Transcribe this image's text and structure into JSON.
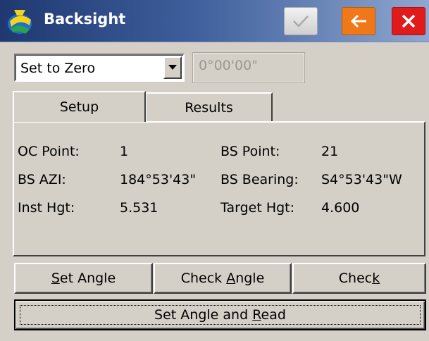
{
  "window": {
    "title": "Backsight",
    "buttons": {
      "ok": "checkmark-icon",
      "back": "back-arrow-icon",
      "close": "close-icon"
    },
    "colors": {
      "titlebar": "#1f3870",
      "back": "#f07818",
      "close": "#e01b1b"
    }
  },
  "mode_select": {
    "value": "Set to Zero"
  },
  "angle_field": {
    "value": "0°00'00\""
  },
  "tabs": [
    {
      "label": "Setup",
      "active": true
    },
    {
      "label": "Results",
      "active": false
    }
  ],
  "setup": {
    "oc_point_label": "OC Point:",
    "oc_point_value": "1",
    "bs_point_label": "BS Point:",
    "bs_point_value": "21",
    "bs_azi_label": "BS AZI:",
    "bs_azi_value": "184°53'43\"",
    "bs_bearing_label": "BS Bearing:",
    "bs_bearing_value": "S4°53'43\"W",
    "inst_hgt_label": "Inst Hgt:",
    "inst_hgt_value": "5.531",
    "target_hgt_label": "Target Hgt:",
    "target_hgt_value": "4.600"
  },
  "actions": {
    "set_angle": {
      "pre": "",
      "key": "S",
      "post": "et Angle"
    },
    "check_angle": {
      "pre": "Check ",
      "key": "A",
      "post": "ngle"
    },
    "check": {
      "pre": "Chec",
      "key": "k",
      "post": ""
    },
    "set_angle_and_read": {
      "pre": "Set Angle and ",
      "key": "R",
      "post": "ead"
    }
  }
}
